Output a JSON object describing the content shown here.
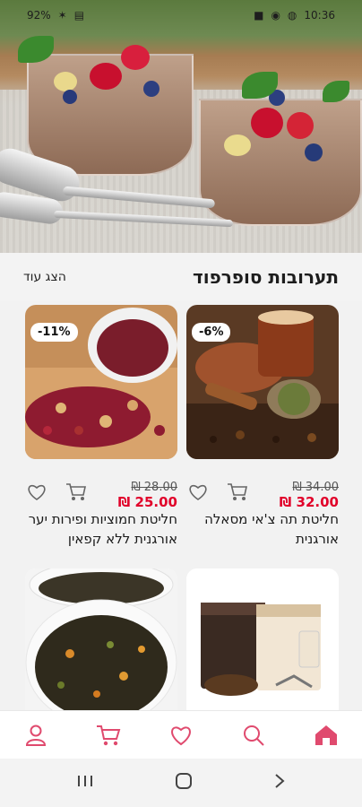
{
  "status_bar": {
    "battery": "92%",
    "time": "10:36"
  },
  "section": {
    "title": "תערובות סופרפוד",
    "show_more": "הצג עוד"
  },
  "products": [
    {
      "name": "חליטת תה צ'אי מסאלה אורגנית",
      "discount": "-6%",
      "old_price": "₪ 34.00",
      "new_price": "₪ 32.00"
    },
    {
      "name": "חליטת חמוציות ופירות יער אורגנית ללא קפאין",
      "discount": "-11%",
      "old_price": "₪ 28.00",
      "new_price": "₪ 25.00"
    },
    {
      "name": "",
      "discount": "",
      "old_price": "",
      "new_price": ""
    },
    {
      "name": "",
      "discount": "",
      "old_price": "",
      "new_price": ""
    }
  ],
  "colors": {
    "accent": "#e1002a",
    "nav_icon": "#e04a6e"
  },
  "icons": [
    "home-icon",
    "search-icon",
    "heart-icon",
    "cart-icon",
    "user-icon"
  ]
}
